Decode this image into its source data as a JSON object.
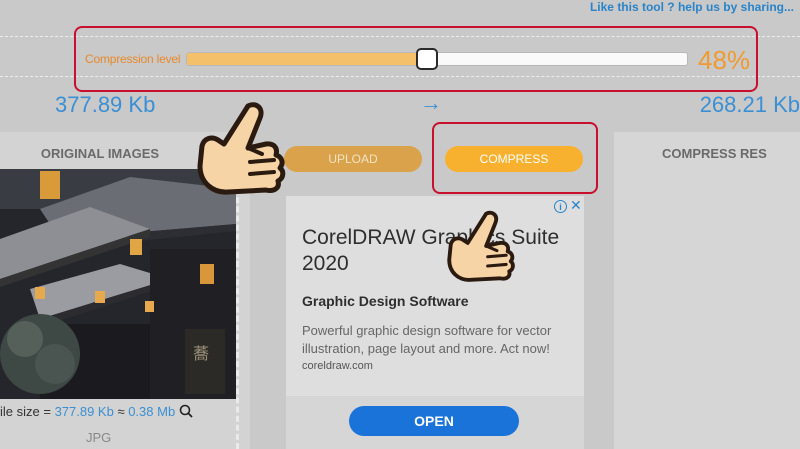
{
  "header": {
    "share_link": "Like this tool ? help us by sharing..."
  },
  "compression": {
    "label": "Compression level",
    "value_text": "48%",
    "level_fraction": 0.48
  },
  "sizes": {
    "original": "377.89 Kb",
    "arrow": "→",
    "compressed": "268.21 Kb"
  },
  "original_panel": {
    "heading": "ORIGINAL IMAGES",
    "file_size_prefix": "ile size = ",
    "file_size_kb": "377.89 Kb",
    "approx": " ≈ ",
    "file_size_mb": "0.38 Mb",
    "file_type": "JPG"
  },
  "buttons": {
    "upload": "UPLOAD",
    "compress": "COMPRESS"
  },
  "ad": {
    "headline": "CorelDRAW Graphics Suite 2020",
    "subhead": "Graphic Design Software",
    "description": "Powerful graphic design software for vector illustration, page layout and more. Act now!",
    "domain": "coreldraw.com",
    "open_button": "OPEN",
    "info_icon": "i",
    "close_icon": "✕"
  },
  "results_panel": {
    "heading": "COMPRESS RES"
  },
  "colors": {
    "accent_orange": "#f09a30",
    "link_blue": "#3b8fd4",
    "highlight_red": "#c8102e"
  },
  "icons": [
    "pointing-hand-icon",
    "magnifier-icon",
    "arrow-right-icon",
    "info-icon",
    "close-icon"
  ]
}
